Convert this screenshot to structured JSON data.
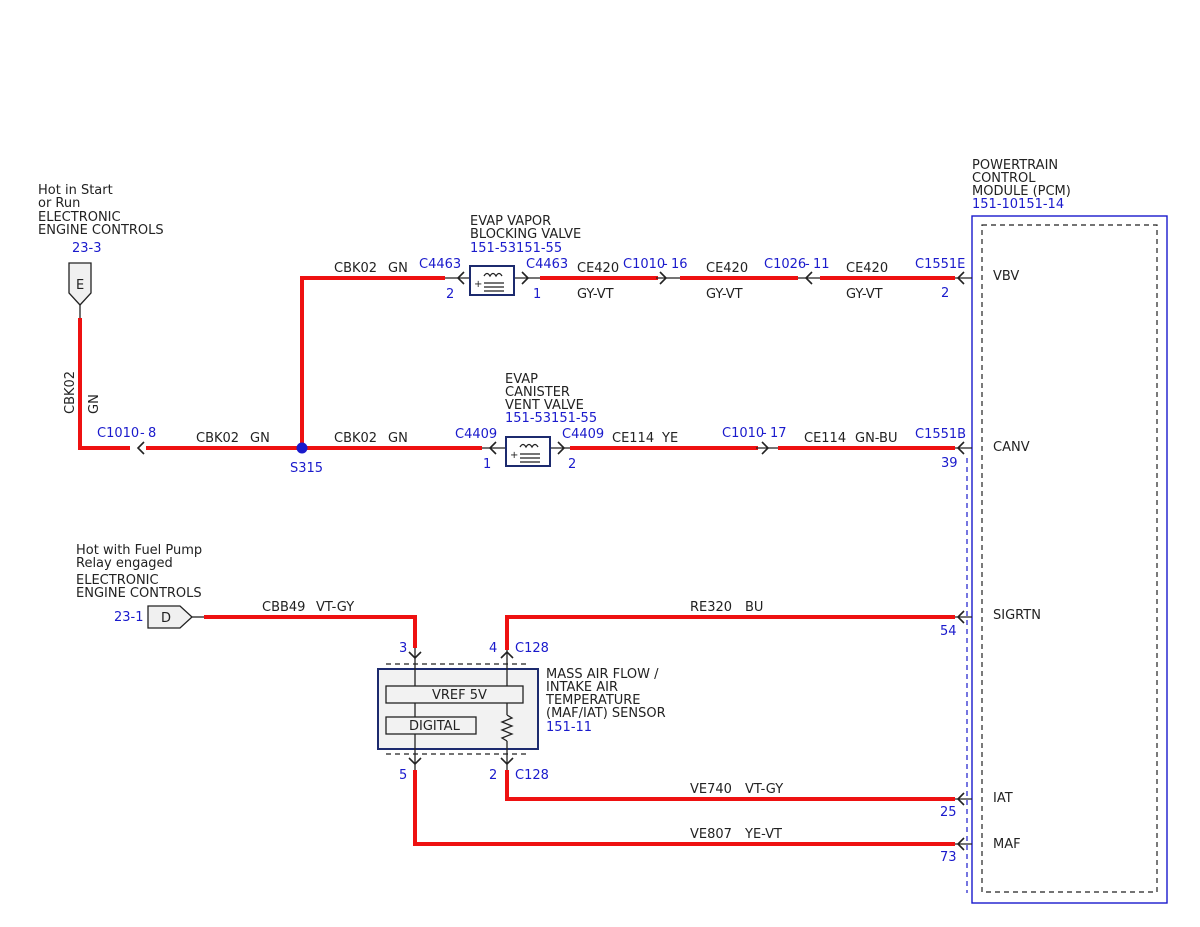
{
  "colors": {
    "wire": "#ee1111",
    "ref": "#1a1acc",
    "module_border": "#1a1acc",
    "module_fill": "#f2f2f2",
    "component_border": "#1c2a6e"
  },
  "sources": {
    "hot_start_run": {
      "line1": "Hot in Start",
      "line2": "or Run",
      "line3": "ELECTRONIC",
      "line4": "ENGINE CONTROLS",
      "ref": "23-3",
      "pin": "E"
    },
    "hot_fuel_pump": {
      "line1": "Hot with Fuel Pump",
      "line2": "Relay engaged",
      "line3": "ELECTRONIC",
      "line4": "ENGINE CONTROLS",
      "ref": "23-1",
      "pin": "D"
    }
  },
  "pcm": {
    "name_line1": "POWERTRAIN",
    "name_line2": "CONTROL",
    "name_line3": "MODULE (PCM)",
    "ref": "151-10151-14",
    "pins": [
      {
        "label": "VBV",
        "connector": "C1551E",
        "pin": "2"
      },
      {
        "label": "CANV",
        "connector": "C1551B",
        "pin": "39"
      },
      {
        "label": "SIGRTN",
        "pin": "54"
      },
      {
        "label": "IAT",
        "pin": "25"
      },
      {
        "label": "MAF",
        "pin": "73"
      }
    ]
  },
  "evap_vapor_valve": {
    "line1": "EVAP VAPOR",
    "line2": "BLOCKING VALVE",
    "ref": "151-53151-55",
    "conn_in": "C4463",
    "pin_in": "2",
    "conn_out": "C4463",
    "pin_out": "1"
  },
  "evap_vent_valve": {
    "line1": "EVAP",
    "line2": "CANISTER",
    "line3": "VENT VALVE",
    "ref": "151-53151-55",
    "conn_in": "C4409",
    "pin_in": "1",
    "conn_out": "C4409",
    "pin_out": "2"
  },
  "maf_sensor": {
    "line1": "MASS AIR FLOW /",
    "line2": "INTAKE AIR",
    "line3": "TEMPERATURE",
    "line4": "(MAF/IAT) SENSOR",
    "ref": "151-11",
    "vref": "VREF 5V",
    "digital": "DIGITAL",
    "pin_top_left": "3",
    "pin_top_right": "4",
    "conn_top": "C128",
    "pin_bottom_left": "5",
    "pin_bottom_right": "2",
    "conn_bottom": "C128"
  },
  "inline_connectors": {
    "c1010_16": {
      "name": "C1010",
      "pin": "16"
    },
    "c1026_11": {
      "name": "C1026",
      "pin": "11"
    },
    "c1010_17": {
      "name": "C1010",
      "pin": "17"
    },
    "c1010_8": {
      "name": "C1010",
      "pin": "8"
    }
  },
  "splice": {
    "name": "S315"
  },
  "wires": {
    "cbk02_vertical": {
      "circuit": "CBK02",
      "color": "GN"
    },
    "cbk02_left": {
      "circuit": "CBK02",
      "color": "GN"
    },
    "cbk02_mid": {
      "circuit": "CBK02",
      "color": "GN"
    },
    "cbk02_top": {
      "circuit": "CBK02",
      "color": "GN"
    },
    "ce420_a": {
      "circuit": "CE420",
      "color": "GY-VT"
    },
    "ce420_b": {
      "circuit": "CE420",
      "color": "GY-VT"
    },
    "ce420_c": {
      "circuit": "CE420",
      "color": "GY-VT"
    },
    "ce114_a": {
      "circuit": "CE114",
      "color": "YE"
    },
    "ce114_b": {
      "circuit": "CE114",
      "color": "GN-BU"
    },
    "cbb49": {
      "circuit": "CBB49",
      "color": "VT-GY"
    },
    "re320": {
      "circuit": "RE320",
      "color": "BU"
    },
    "ve740": {
      "circuit": "VE740",
      "color": "VT-GY"
    },
    "ve807": {
      "circuit": "VE807",
      "color": "YE-VT"
    }
  }
}
